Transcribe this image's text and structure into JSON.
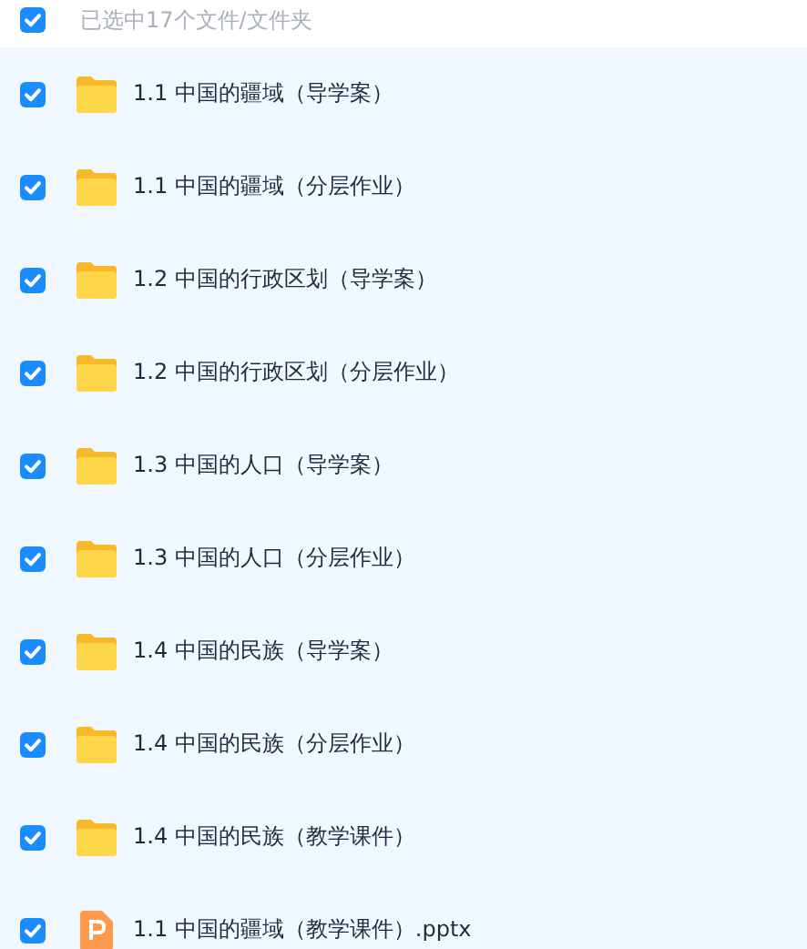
{
  "header": {
    "checked": true,
    "label": "已选中17个文件/文件夹"
  },
  "files": [
    {
      "kind": "folder",
      "name": "1.1 中国的疆域（导学案）",
      "checked": true
    },
    {
      "kind": "folder",
      "name": "1.1 中国的疆域（分层作业）",
      "checked": true
    },
    {
      "kind": "folder",
      "name": "1.2 中国的行政区划（导学案）",
      "checked": true
    },
    {
      "kind": "folder",
      "name": "1.2 中国的行政区划（分层作业）",
      "checked": true
    },
    {
      "kind": "folder",
      "name": "1.3 中国的人口（导学案）",
      "checked": true
    },
    {
      "kind": "folder",
      "name": "1.3 中国的人口（分层作业）",
      "checked": true
    },
    {
      "kind": "folder",
      "name": "1.4 中国的民族（导学案）",
      "checked": true
    },
    {
      "kind": "folder",
      "name": "1.4 中国的民族（分层作业）",
      "checked": true
    },
    {
      "kind": "folder",
      "name": "1.4 中国的民族（教学课件）",
      "checked": true
    },
    {
      "kind": "pptx",
      "name": "1.1 中国的疆域（教学课件）.pptx",
      "checked": true
    }
  ]
}
